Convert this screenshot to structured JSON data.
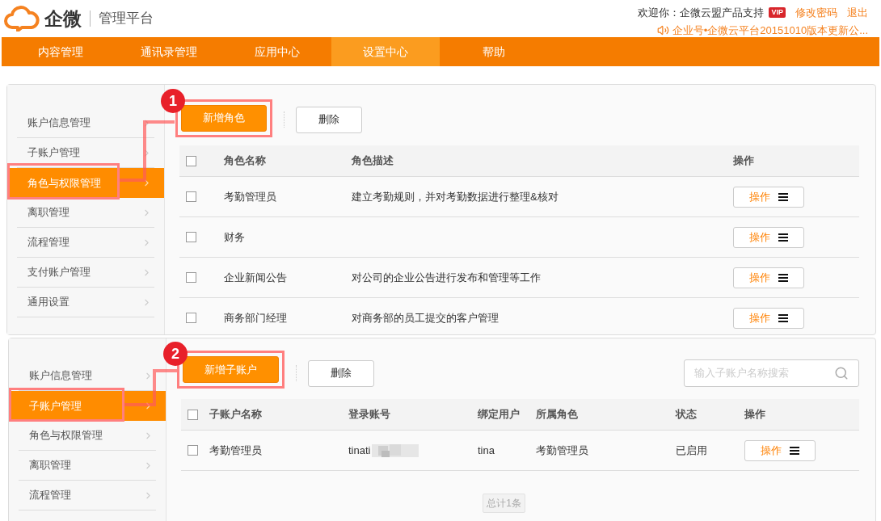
{
  "header": {
    "logo_text": "企微",
    "platform": "管理平台",
    "welcome": "欢迎你：企微云盟产品支持",
    "badge": "VIP",
    "links": [
      "修改密码",
      "退出"
    ],
    "notice": "企业号•企微云平台20151010版本更新公..."
  },
  "nav": [
    {
      "label": "内容管理",
      "selected": false
    },
    {
      "label": "通讯录管理",
      "selected": false
    },
    {
      "label": "应用中心",
      "selected": false
    },
    {
      "label": "设置中心",
      "selected": true
    },
    {
      "label": "帮助",
      "selected": false
    }
  ],
  "panels": [
    {
      "kind": "roles",
      "step": "1",
      "sidebar": [
        {
          "label": "账户信息管理",
          "selected": false
        },
        {
          "label": "子账户管理",
          "selected": false
        },
        {
          "label": "角色与权限管理",
          "selected": true
        },
        {
          "label": "离职管理",
          "selected": false
        },
        {
          "label": "流程管理",
          "selected": false
        },
        {
          "label": "支付账户管理",
          "selected": false
        },
        {
          "label": "通用设置",
          "selected": false
        }
      ],
      "primary_button": "新增角色",
      "secondary_button": "删除",
      "select_all_checked": false,
      "columns": [
        "角色名称",
        "角色描述",
        "操作"
      ],
      "rows": [
        {
          "checked": false,
          "cells": [
            {
              "text": "考勤管理员"
            },
            {
              "text": "建立考勤规则，并对考勤数据进行整理&核对"
            }
          ],
          "action": "操作"
        },
        {
          "checked": false,
          "cells": [
            {
              "text": "财务"
            },
            {
              "text": ""
            }
          ],
          "action": "操作"
        },
        {
          "checked": false,
          "cells": [
            {
              "text": "企业新闻公告"
            },
            {
              "text": "对公司的企业公告进行发布和管理等工作"
            }
          ],
          "action": "操作"
        },
        {
          "checked": false,
          "cells": [
            {
              "text": "商务部门经理"
            },
            {
              "text": "对商务部的员工提交的客户管理"
            }
          ],
          "action": "操作"
        }
      ]
    },
    {
      "kind": "subaccounts",
      "step": "2",
      "sidebar": [
        {
          "label": "账户信息管理",
          "selected": false
        },
        {
          "label": "子账户管理",
          "selected": true
        },
        {
          "label": "角色与权限管理",
          "selected": false
        },
        {
          "label": "离职管理",
          "selected": false
        },
        {
          "label": "流程管理",
          "selected": false
        }
      ],
      "primary_button": "新增子账户",
      "secondary_button": "删除",
      "search": {
        "placeholder": "输入子账户名称搜索"
      },
      "select_all_checked": false,
      "columns": [
        "子账户名称",
        "登录账号",
        "绑定用户",
        "所属角色",
        "状态",
        "操作"
      ],
      "rows": [
        {
          "checked": false,
          "cells": [
            {
              "text": "考勤管理员"
            },
            {
              "text": "tinati",
              "blurred": true
            },
            {
              "text": "tina"
            },
            {
              "text": "考勤管理员"
            },
            {
              "text": "已启用"
            }
          ],
          "action": "操作"
        }
      ],
      "total": "总计1条"
    }
  ]
}
